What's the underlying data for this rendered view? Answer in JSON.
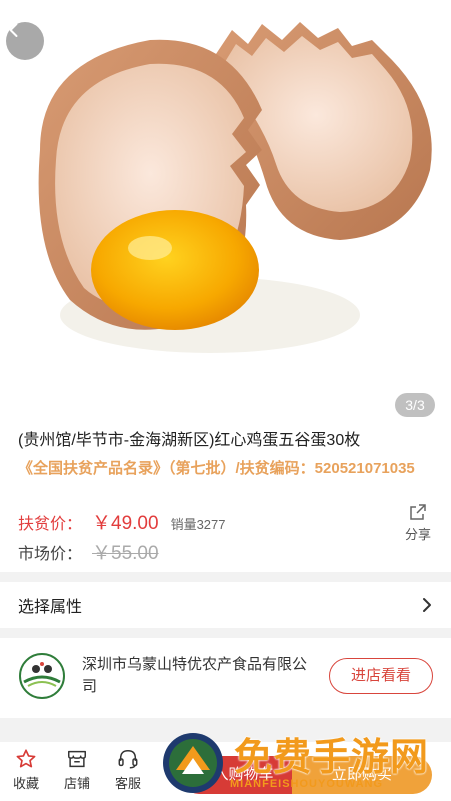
{
  "gallery": {
    "counter": "3/3"
  },
  "product": {
    "title": "(贵州馆/毕节市-金海湖新区)红心鸡蛋五谷蛋30枚",
    "subtitle": "《全国扶贫产品名录》（第七批）/扶贫编码：520521071035",
    "price_label": "扶贫价：",
    "price_value": "￥49.00",
    "sales": "销量3277",
    "market_label": "市场价：",
    "market_value": "￥55.00",
    "share_label": "分享"
  },
  "attributes": {
    "label": "选择属性"
  },
  "store": {
    "name": "深圳市乌蒙山特优农产食品有限公司",
    "visit_label": "进店看看"
  },
  "bottom_bar": {
    "favorite_label": "收藏",
    "shop_label": "店铺",
    "service_label": "客服",
    "cart_label": "加入购物车",
    "buy_label": "立即购买"
  },
  "watermark": {
    "text": "免费手游网",
    "subtext": "MIANFEISHOUYOUWANG"
  },
  "colors": {
    "accent_red": "#d73b36",
    "accent_orange": "#f0a23a",
    "subtitle_orange": "#e8a25c"
  }
}
